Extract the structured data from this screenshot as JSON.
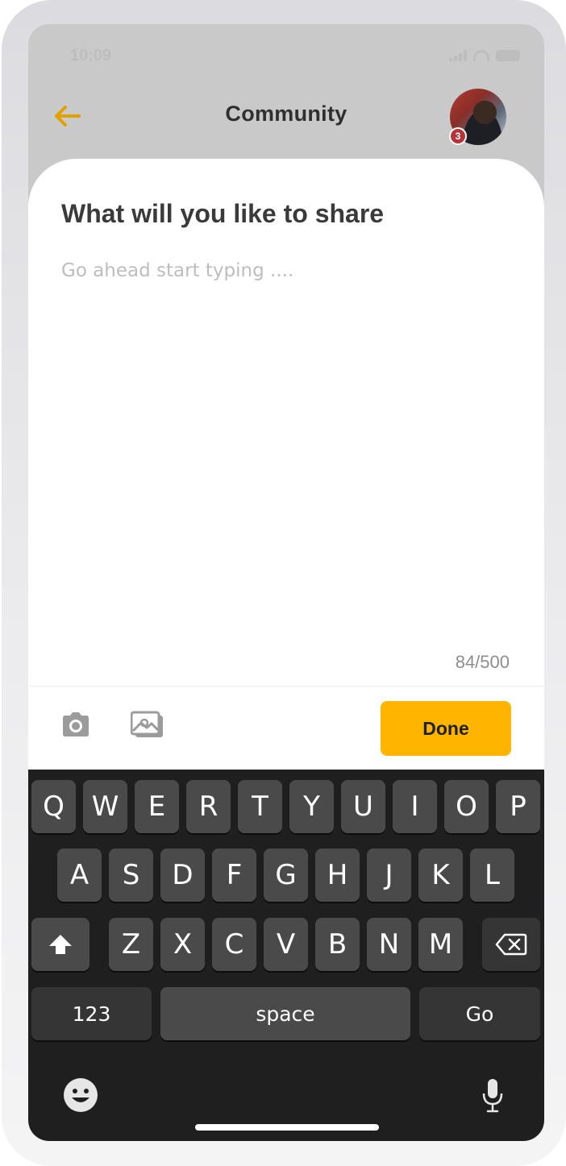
{
  "status_bar": {
    "time": "10:09"
  },
  "header": {
    "title": "Community",
    "back_icon": "arrow-left-icon",
    "notification_count": "3",
    "accent_color": "#e0a100"
  },
  "compose": {
    "heading": "What will you like to share",
    "placeholder": "Go ahead start typing ....",
    "counter": "84/500"
  },
  "toolbar": {
    "camera_icon": "camera-icon",
    "gallery_icon": "gallery-icon",
    "done_label": "Done",
    "done_color": "#ffb400"
  },
  "keyboard": {
    "row1": [
      "Q",
      "W",
      "E",
      "R",
      "T",
      "Y",
      "U",
      "I",
      "O",
      "P"
    ],
    "row2": [
      "A",
      "S",
      "D",
      "F",
      "G",
      "H",
      "J",
      "K",
      "L"
    ],
    "row3": [
      "Z",
      "X",
      "C",
      "V",
      "B",
      "N",
      "M"
    ],
    "numbers_label": "123",
    "space_label": "space",
    "go_label": "Go",
    "shift_icon": "shift-icon",
    "delete_icon": "backspace-icon",
    "emoji_icon": "emoji-icon",
    "mic_icon": "microphone-icon"
  }
}
